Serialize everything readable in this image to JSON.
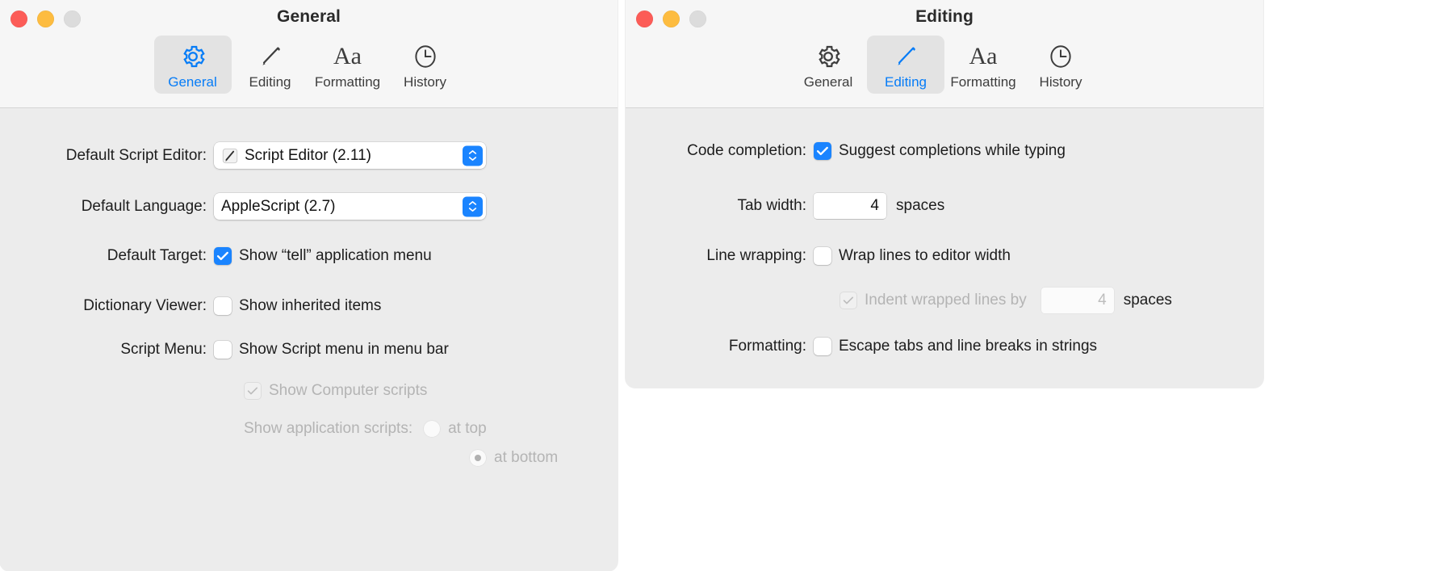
{
  "colors": {
    "accent_blue": "#1a84ff",
    "label_blue": "#067cf7",
    "window_bg": "#ececec",
    "toolbar_bg": "#f6f6f6",
    "disabled_text": "#b4b4b4"
  },
  "general_window": {
    "title": "General",
    "tabs": [
      {
        "label": "General",
        "icon": "gear-icon",
        "selected": true
      },
      {
        "label": "Editing",
        "icon": "pencil-icon",
        "selected": false
      },
      {
        "label": "Formatting",
        "icon": "font-aa-icon",
        "selected": false
      },
      {
        "label": "History",
        "icon": "clock-icon",
        "selected": false
      }
    ],
    "rows": {
      "default_script_editor": {
        "label": "Default Script Editor:",
        "value": "Script Editor (2.11)",
        "icon": "script-editor-app-icon"
      },
      "default_language": {
        "label": "Default Language:",
        "value": "AppleScript (2.7)"
      },
      "default_target": {
        "label": "Default Target:",
        "checkbox_label": "Show “tell” application menu",
        "checked": true
      },
      "dictionary_viewer": {
        "label": "Dictionary Viewer:",
        "checkbox_label": "Show inherited items",
        "checked": false
      },
      "script_menu": {
        "label": "Script Menu:",
        "checkbox_label": "Show Script menu in menu bar",
        "checked": false,
        "sub_computer_scripts": {
          "label": "Show Computer scripts",
          "checked": true,
          "disabled": true
        },
        "sub_application_scripts": {
          "label": "Show application scripts:",
          "disabled": true,
          "options": [
            {
              "label": "at top",
              "selected": false
            },
            {
              "label": "at bottom",
              "selected": true
            }
          ]
        }
      }
    }
  },
  "editing_window": {
    "title": "Editing",
    "tabs": [
      {
        "label": "General",
        "icon": "gear-icon",
        "selected": false
      },
      {
        "label": "Editing",
        "icon": "pencil-icon",
        "selected": true
      },
      {
        "label": "Formatting",
        "icon": "font-aa-icon",
        "selected": false
      },
      {
        "label": "History",
        "icon": "clock-icon",
        "selected": false
      }
    ],
    "rows": {
      "code_completion": {
        "label": "Code completion:",
        "checkbox_label": "Suggest completions while typing",
        "checked": true
      },
      "tab_width": {
        "label": "Tab width:",
        "value": "4",
        "unit": "spaces"
      },
      "line_wrapping": {
        "label": "Line wrapping:",
        "checkbox_label": "Wrap lines to editor width",
        "checked": false,
        "sub_indent": {
          "label": "Indent wrapped lines by",
          "checked": true,
          "disabled": true,
          "value": "4",
          "unit": "spaces"
        }
      },
      "formatting": {
        "label": "Formatting:",
        "checkbox_label": "Escape tabs and line breaks in strings",
        "checked": false
      }
    }
  }
}
